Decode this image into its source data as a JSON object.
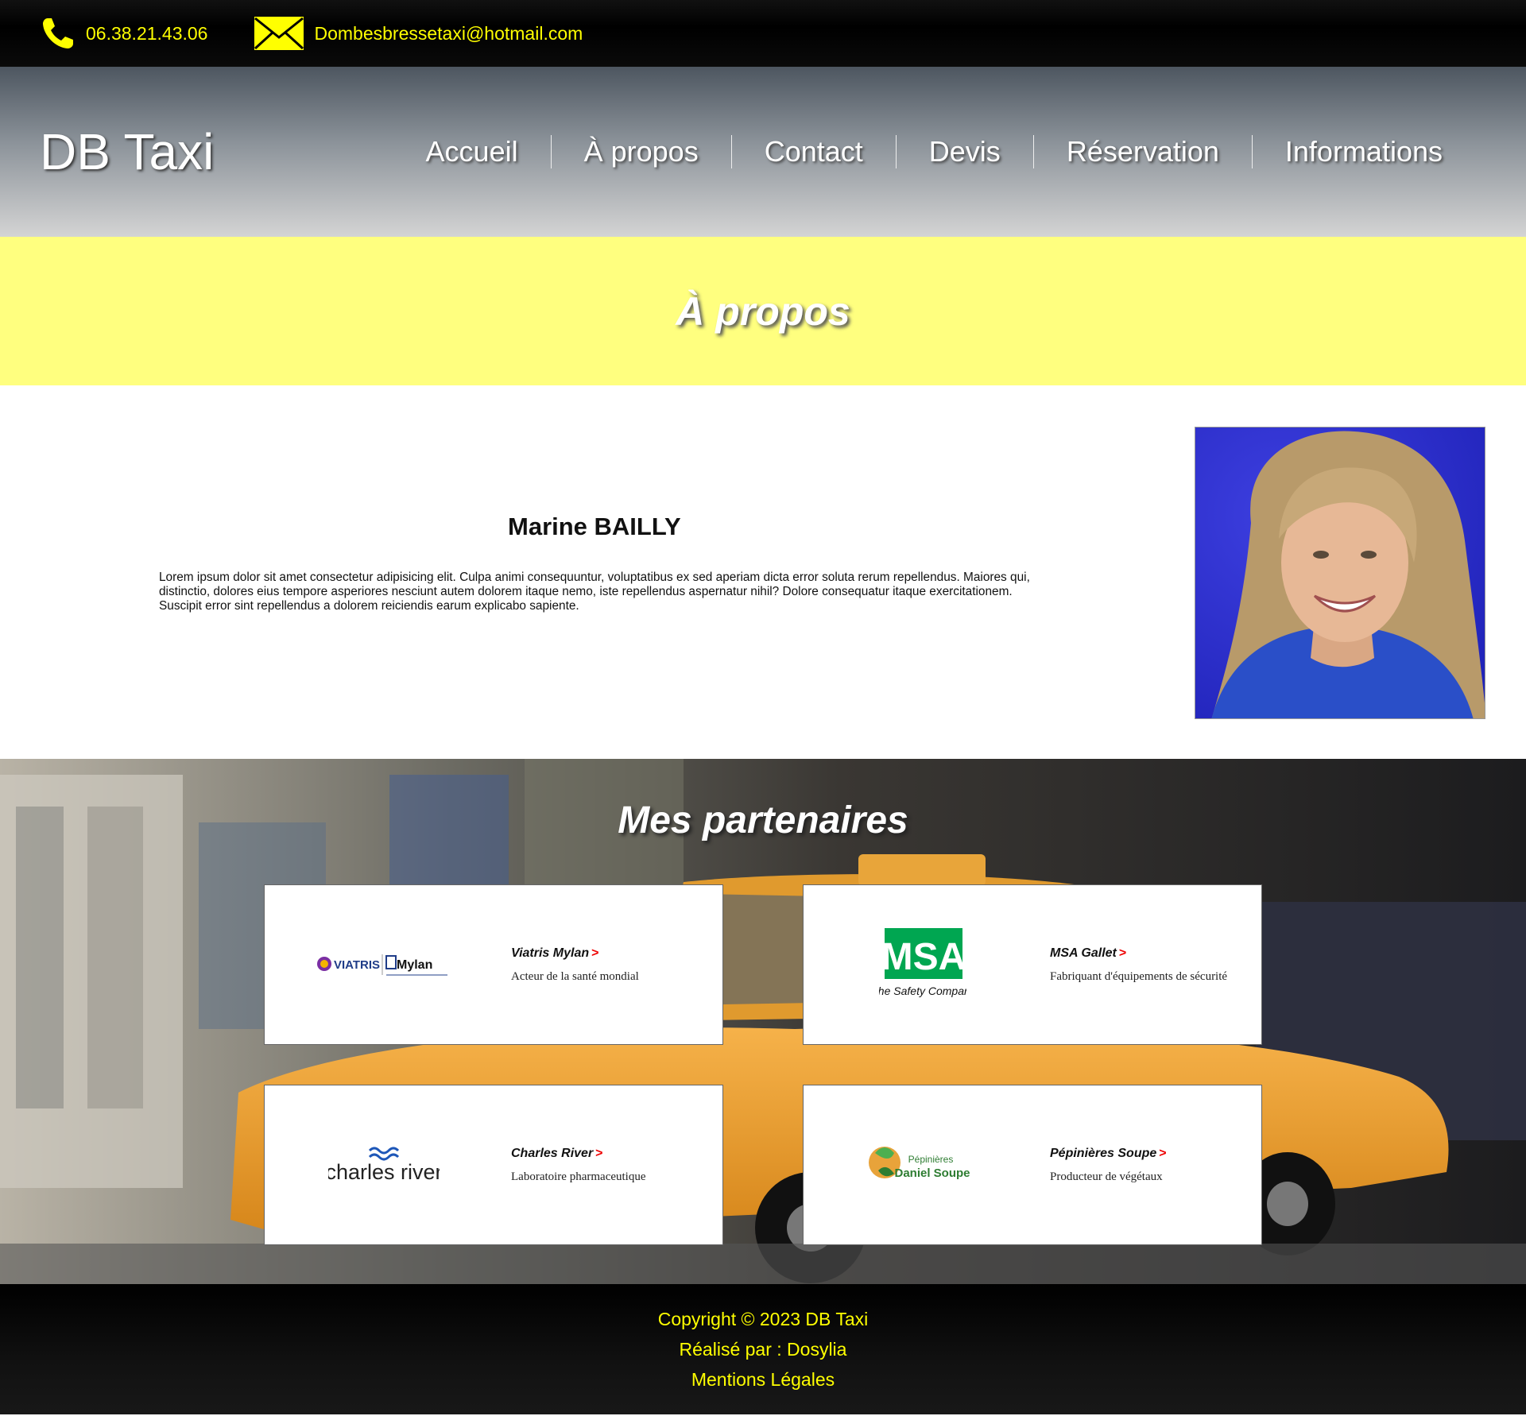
{
  "topbar": {
    "phone": "06.38.21.43.06",
    "email": "Dombesbressetaxi@hotmail.com",
    "icons": [
      "phone-icon",
      "mail-icon"
    ],
    "color": "#ffff00"
  },
  "header": {
    "logo": "DB Taxi",
    "nav": [
      {
        "label": "Accueil"
      },
      {
        "label": "À propos"
      },
      {
        "label": "Contact"
      },
      {
        "label": "Devis"
      },
      {
        "label": "Réservation"
      },
      {
        "label": "Informations"
      }
    ]
  },
  "hero": {
    "title": "À propos",
    "background": "#ffff7f"
  },
  "about": {
    "name": "Marine BAILLY",
    "text": "Lorem ipsum dolor sit amet consectetur adipisicing elit. Culpa animi consequuntur, voluptatibus ex sed aperiam dicta error soluta rerum repellendus. Maiores qui, distinctio, dolores eius tempore asperiores nesciunt autem dolorem itaque nemo, iste repellendus aspernatur nihil? Dolore consequatur itaque exercitationem. Suscipit error sint repellendus a dolorem reiciendis earum explicabo sapiente."
  },
  "partners": {
    "title": "Mes partenaires",
    "items": [
      {
        "name": "Viatris Mylan",
        "desc": "Acteur de la santé mondial",
        "logo_text": [
          "VIATRIS",
          "Mylan"
        ]
      },
      {
        "name": "MSA Gallet",
        "desc": "Fabriquant d'équipements de sécurité",
        "logo_text": [
          "MSA",
          "The Safety Company"
        ]
      },
      {
        "name": "Charles River",
        "desc": "Laboratoire pharmaceutique",
        "logo_text": [
          "charles river"
        ]
      },
      {
        "name": "Pépinières Soupe",
        "desc": "Producteur de végétaux",
        "logo_text": [
          "Pépinières",
          "Daniel Soupe"
        ]
      }
    ],
    "arrow": ">"
  },
  "footer": {
    "copyright": "Copyright © 2023 DB Taxi",
    "credit": "Réalisé par : Dosylia",
    "legal": "Mentions Légales"
  }
}
